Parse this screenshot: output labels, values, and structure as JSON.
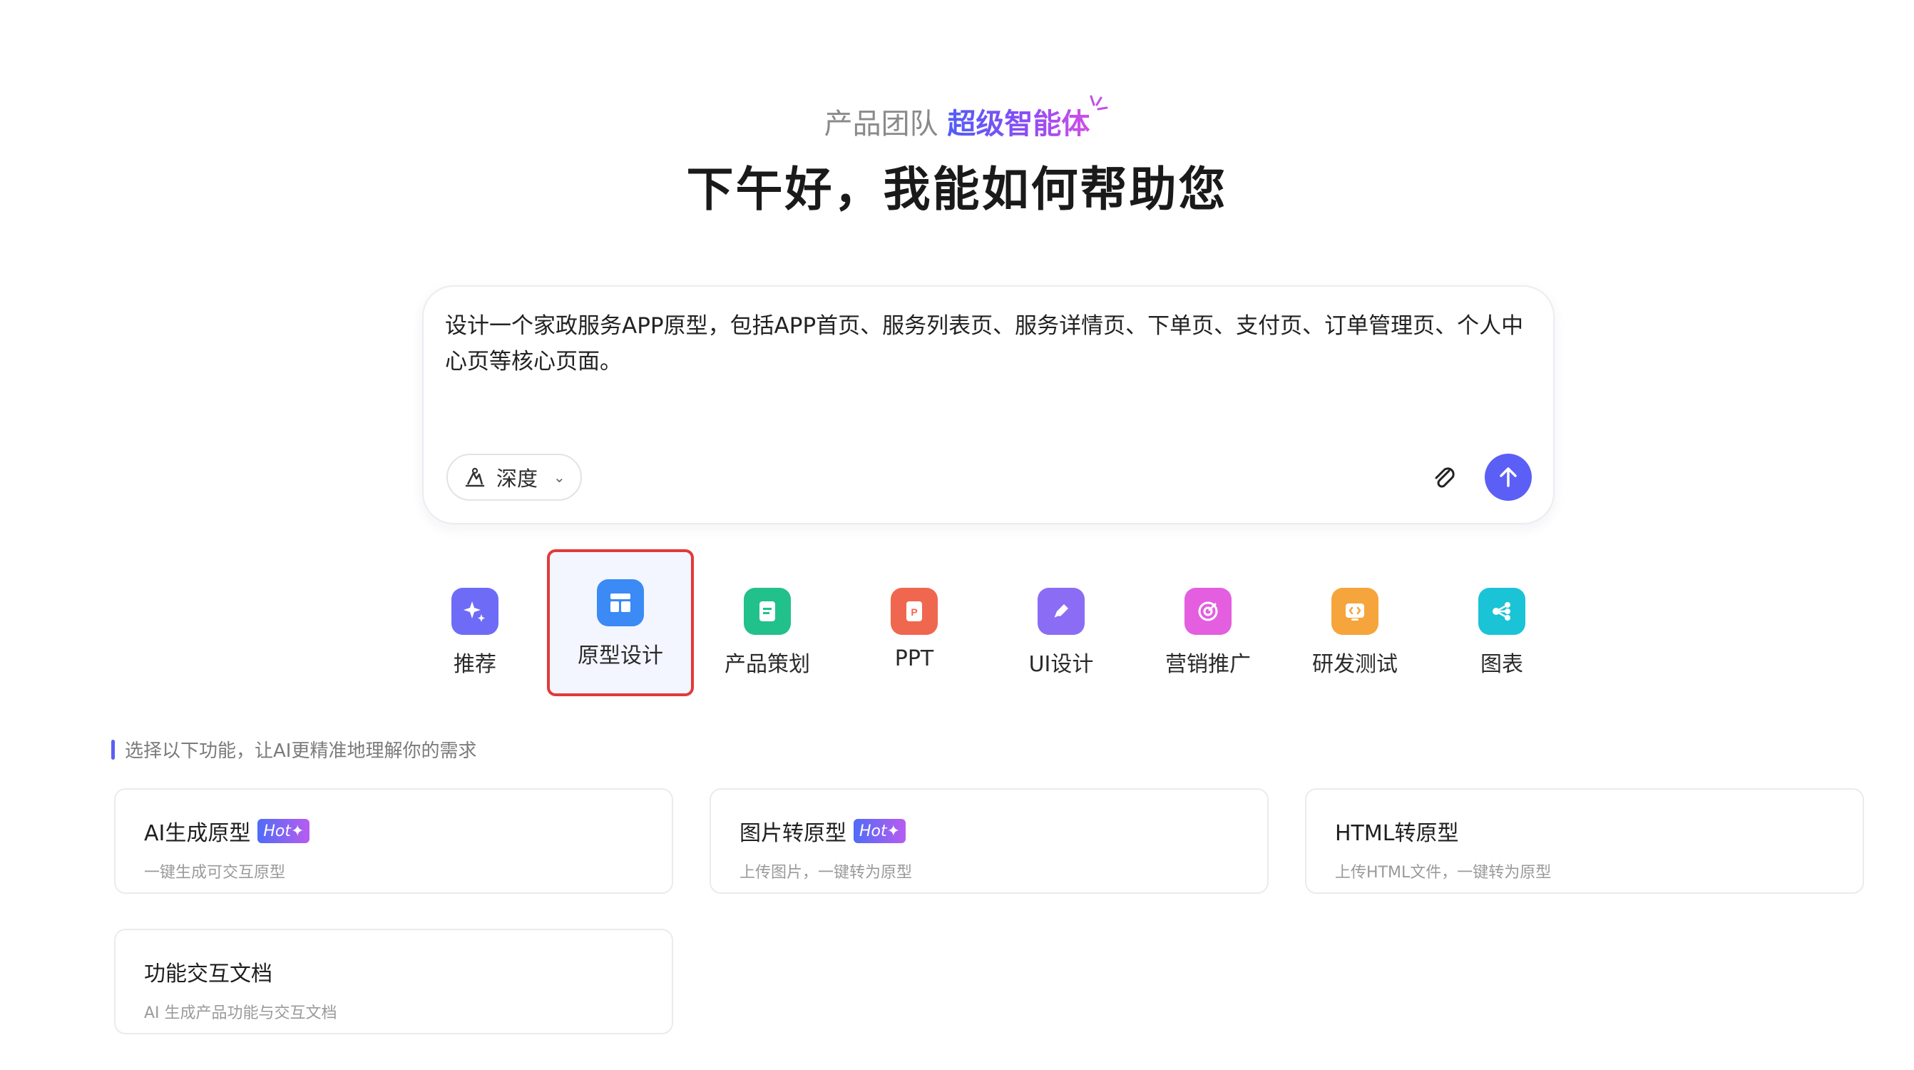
{
  "header": {
    "tagline_prefix": "产品团队",
    "tagline_highlight": "超级智能体",
    "greeting": "下午好，我能如何帮助您"
  },
  "prompt": {
    "text": "设计一个家政服务APP原型，包括APP首页、服务列表页、服务详情页、下单页、支付页、订单管理页、个人中心页等核心页面。",
    "mode_label": "深度"
  },
  "categories": [
    {
      "label": "推荐",
      "color": "#6e6cf6",
      "icon": "sparkle-icon"
    },
    {
      "label": "原型设计",
      "color": "#3b8af5",
      "icon": "layout-icon",
      "selected": true
    },
    {
      "label": "产品策划",
      "color": "#22c08a",
      "icon": "document-icon"
    },
    {
      "label": "PPT",
      "color": "#f0674f",
      "icon": "ppt-icon"
    },
    {
      "label": "UI设计",
      "color": "#8b6cf5",
      "icon": "pen-icon"
    },
    {
      "label": "营销推广",
      "color": "#e35fe0",
      "icon": "target-icon"
    },
    {
      "label": "研发测试",
      "color": "#f5a53c",
      "icon": "code-icon"
    },
    {
      "label": "图表",
      "color": "#1bc3d6",
      "icon": "share-icon"
    }
  ],
  "hint": "选择以下功能，让AI更精准地理解你的需求",
  "cards": [
    {
      "title": "AI生成原型",
      "badge": "Hot",
      "subtitle": "一键生成可交互原型"
    },
    {
      "title": "图片转原型",
      "badge": "Hot",
      "subtitle": "上传图片，一键转为原型"
    },
    {
      "title": "HTML转原型",
      "badge": "",
      "subtitle": "上传HTML文件，一键转为原型"
    },
    {
      "title": "功能交互文档",
      "badge": "",
      "subtitle": "AI 生成产品功能与交互文档"
    }
  ]
}
